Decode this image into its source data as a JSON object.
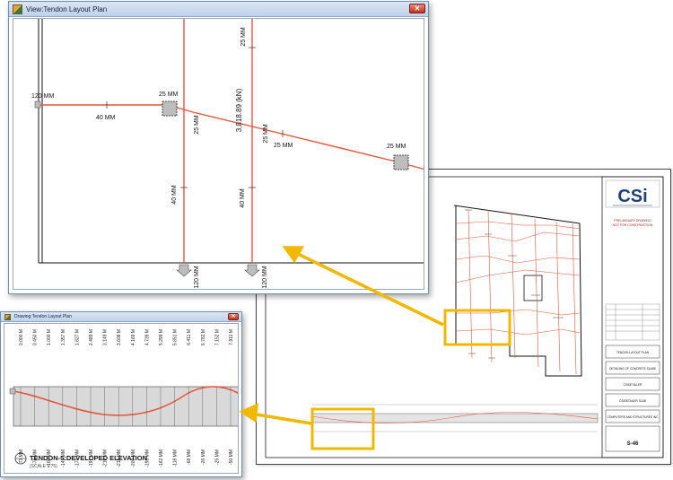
{
  "main_window": {
    "title": "View:Tendon Layout Plan",
    "labels": {
      "left_column_label": "120 MM",
      "top_label_vert_a": "25 MM",
      "seg1_label": "40 MM",
      "col_a_label": "25 MM",
      "col_a_side": "25 MM",
      "force_label": "3,818.89 (kN)",
      "mid_side": "25 MM",
      "seg2_label": "25 MM",
      "right_col_label": "25 MM",
      "lower_a": "40 MM",
      "lower_b": "40 MM",
      "bottom_a": "120 MM",
      "bottom_b": "120 MM"
    }
  },
  "elevation_window": {
    "title": "Drawing:Tendon Layout Plan",
    "heading": "TENDON-5:DEVELOPED ELEVATION",
    "scale": "(SCALE 1:75)",
    "top_ticks": [
      "0.000 M",
      "0.450 M",
      "1.000 M",
      "1.357 M",
      "1.827 M",
      "2.489 M",
      "3.149 M",
      "3.608 M",
      "4.169 M",
      "4.739 M",
      "5.299 M",
      "5.851 M",
      "6.411 M",
      "6.782 M",
      "7.152 M",
      "7.911 M"
    ],
    "bottom_ticks": [
      "-71 MM",
      "-78 MM",
      "-100 MM",
      "-141 MM",
      "-174 MM",
      "-197 MM",
      "-210 MM",
      "-215 MM",
      "-209 MM",
      "-198 MM",
      "-162 MM",
      "-118 MM",
      "-68 MM",
      "-26 MM",
      "-25 MM",
      "-50 MM"
    ]
  },
  "sheet": {
    "logo": "CSi",
    "stamp_line1": "PRELIMINARY DRAWING",
    "stamp_line2": "NOT FOR CONSTRUCTION",
    "block_rows": [
      "TENDON LAYOUT PLAN",
      "DETAILING OF CONCRETE SLABS",
      "CSIDETAILER",
      "CSIDETAILER SLAB",
      "COMPUTERS AND STRUCTURES INC",
      "S-46"
    ]
  },
  "colors": {
    "tendon": "#e8553a",
    "highlight": "#f2b800",
    "window_border": "#6e8fb4"
  }
}
